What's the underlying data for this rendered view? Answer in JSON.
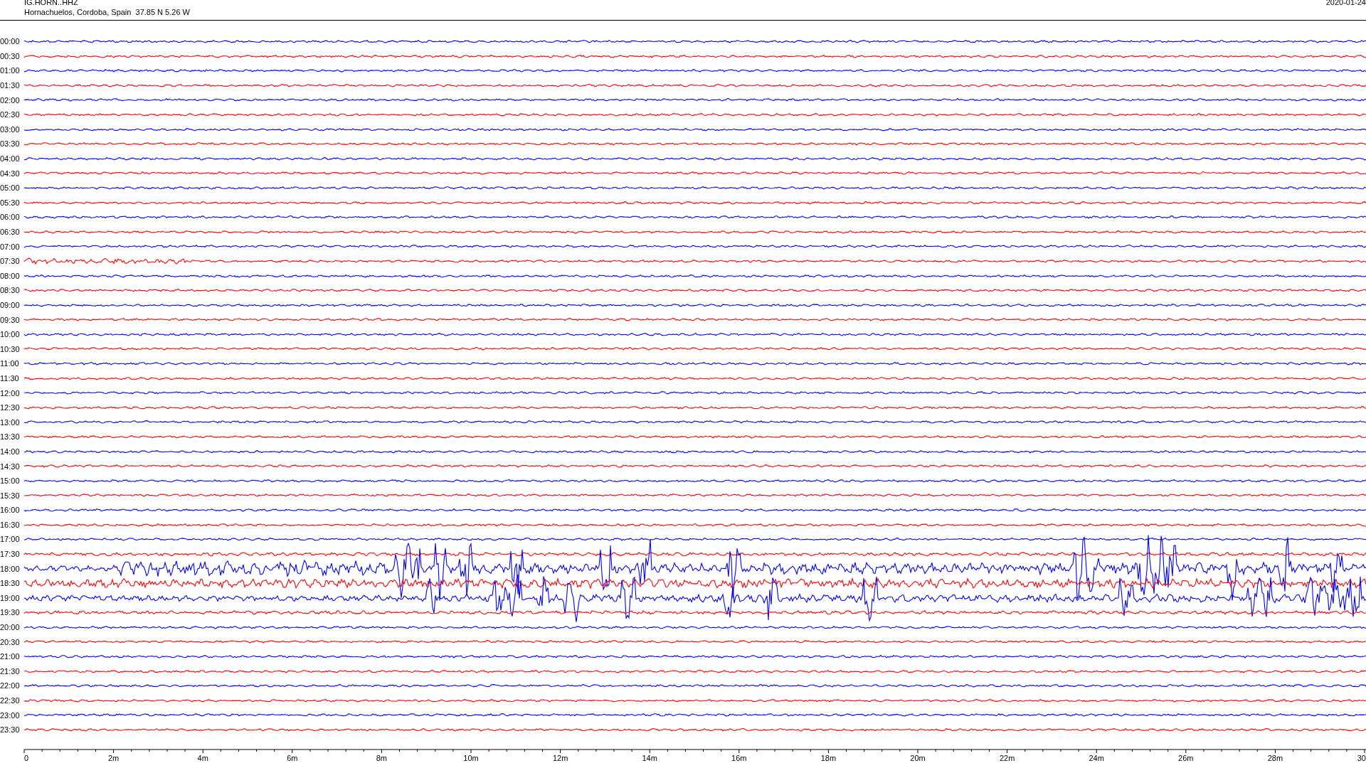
{
  "header": {
    "station": "IG.HORN..HHZ",
    "location": "Hornachuelos, Cordoba, Spain  37.85 N 5.26 W",
    "date": "2020-01-24"
  },
  "helicorder": {
    "rows": [
      {
        "label": "00:00",
        "color": "#0000ff"
      },
      {
        "label": "00:30",
        "color": "#ff0000"
      },
      {
        "label": "01:00",
        "color": "#0000ff"
      },
      {
        "label": "01:30",
        "color": "#ff0000"
      },
      {
        "label": "02:00",
        "color": "#0000ff"
      },
      {
        "label": "02:30",
        "color": "#ff0000"
      },
      {
        "label": "03:00",
        "color": "#0000ff"
      },
      {
        "label": "03:30",
        "color": "#ff0000"
      },
      {
        "label": "04:00",
        "color": "#0000ff"
      },
      {
        "label": "04:30",
        "color": "#ff0000"
      },
      {
        "label": "05:00",
        "color": "#0000ff"
      },
      {
        "label": "05:30",
        "color": "#ff0000"
      },
      {
        "label": "06:00",
        "color": "#0000ff"
      },
      {
        "label": "06:30",
        "color": "#ff0000"
      },
      {
        "label": "07:00",
        "color": "#0000ff"
      },
      {
        "label": "07:30",
        "color": "#ff0000"
      },
      {
        "label": "08:00",
        "color": "#0000ff"
      },
      {
        "label": "08:30",
        "color": "#ff0000"
      },
      {
        "label": "09:00",
        "color": "#0000ff"
      },
      {
        "label": "09:30",
        "color": "#ff0000"
      },
      {
        "label": "10:00",
        "color": "#0000ff"
      },
      {
        "label": "10:30",
        "color": "#ff0000"
      },
      {
        "label": "11:00",
        "color": "#0000ff"
      },
      {
        "label": "11:30",
        "color": "#ff0000"
      },
      {
        "label": "12:00",
        "color": "#0000ff"
      },
      {
        "label": "12:30",
        "color": "#ff0000"
      },
      {
        "label": "13:00",
        "color": "#0000ff"
      },
      {
        "label": "13:30",
        "color": "#ff0000"
      },
      {
        "label": "14:00",
        "color": "#0000ff"
      },
      {
        "label": "14:30",
        "color": "#ff0000"
      },
      {
        "label": "15:00",
        "color": "#0000ff"
      },
      {
        "label": "15:30",
        "color": "#ff0000"
      },
      {
        "label": "16:00",
        "color": "#0000ff"
      },
      {
        "label": "16:30",
        "color": "#ff0000"
      },
      {
        "label": "17:00",
        "color": "#0000ff"
      },
      {
        "label": "17:30",
        "color": "#ff0000"
      },
      {
        "label": "18:00",
        "color": "#0000ff"
      },
      {
        "label": "18:30",
        "color": "#ff0000"
      },
      {
        "label": "19:00",
        "color": "#0000ff"
      },
      {
        "label": "19:30",
        "color": "#ff0000"
      },
      {
        "label": "20:00",
        "color": "#0000ff"
      },
      {
        "label": "20:30",
        "color": "#ff0000"
      },
      {
        "label": "21:00",
        "color": "#0000ff"
      },
      {
        "label": "21:30",
        "color": "#ff0000"
      },
      {
        "label": "22:00",
        "color": "#0000ff"
      },
      {
        "label": "22:30",
        "color": "#ff0000"
      },
      {
        "label": "23:00",
        "color": "#0000ff"
      },
      {
        "label": "23:30",
        "color": "#ff0000"
      }
    ],
    "time_axis": {
      "ticks": [
        "0",
        "2m",
        "4m",
        "6m",
        "8m",
        "10m",
        "12m",
        "14m",
        "16m",
        "18m",
        "20m",
        "22m",
        "24m",
        "26m",
        "28m",
        "30"
      ]
    }
  }
}
